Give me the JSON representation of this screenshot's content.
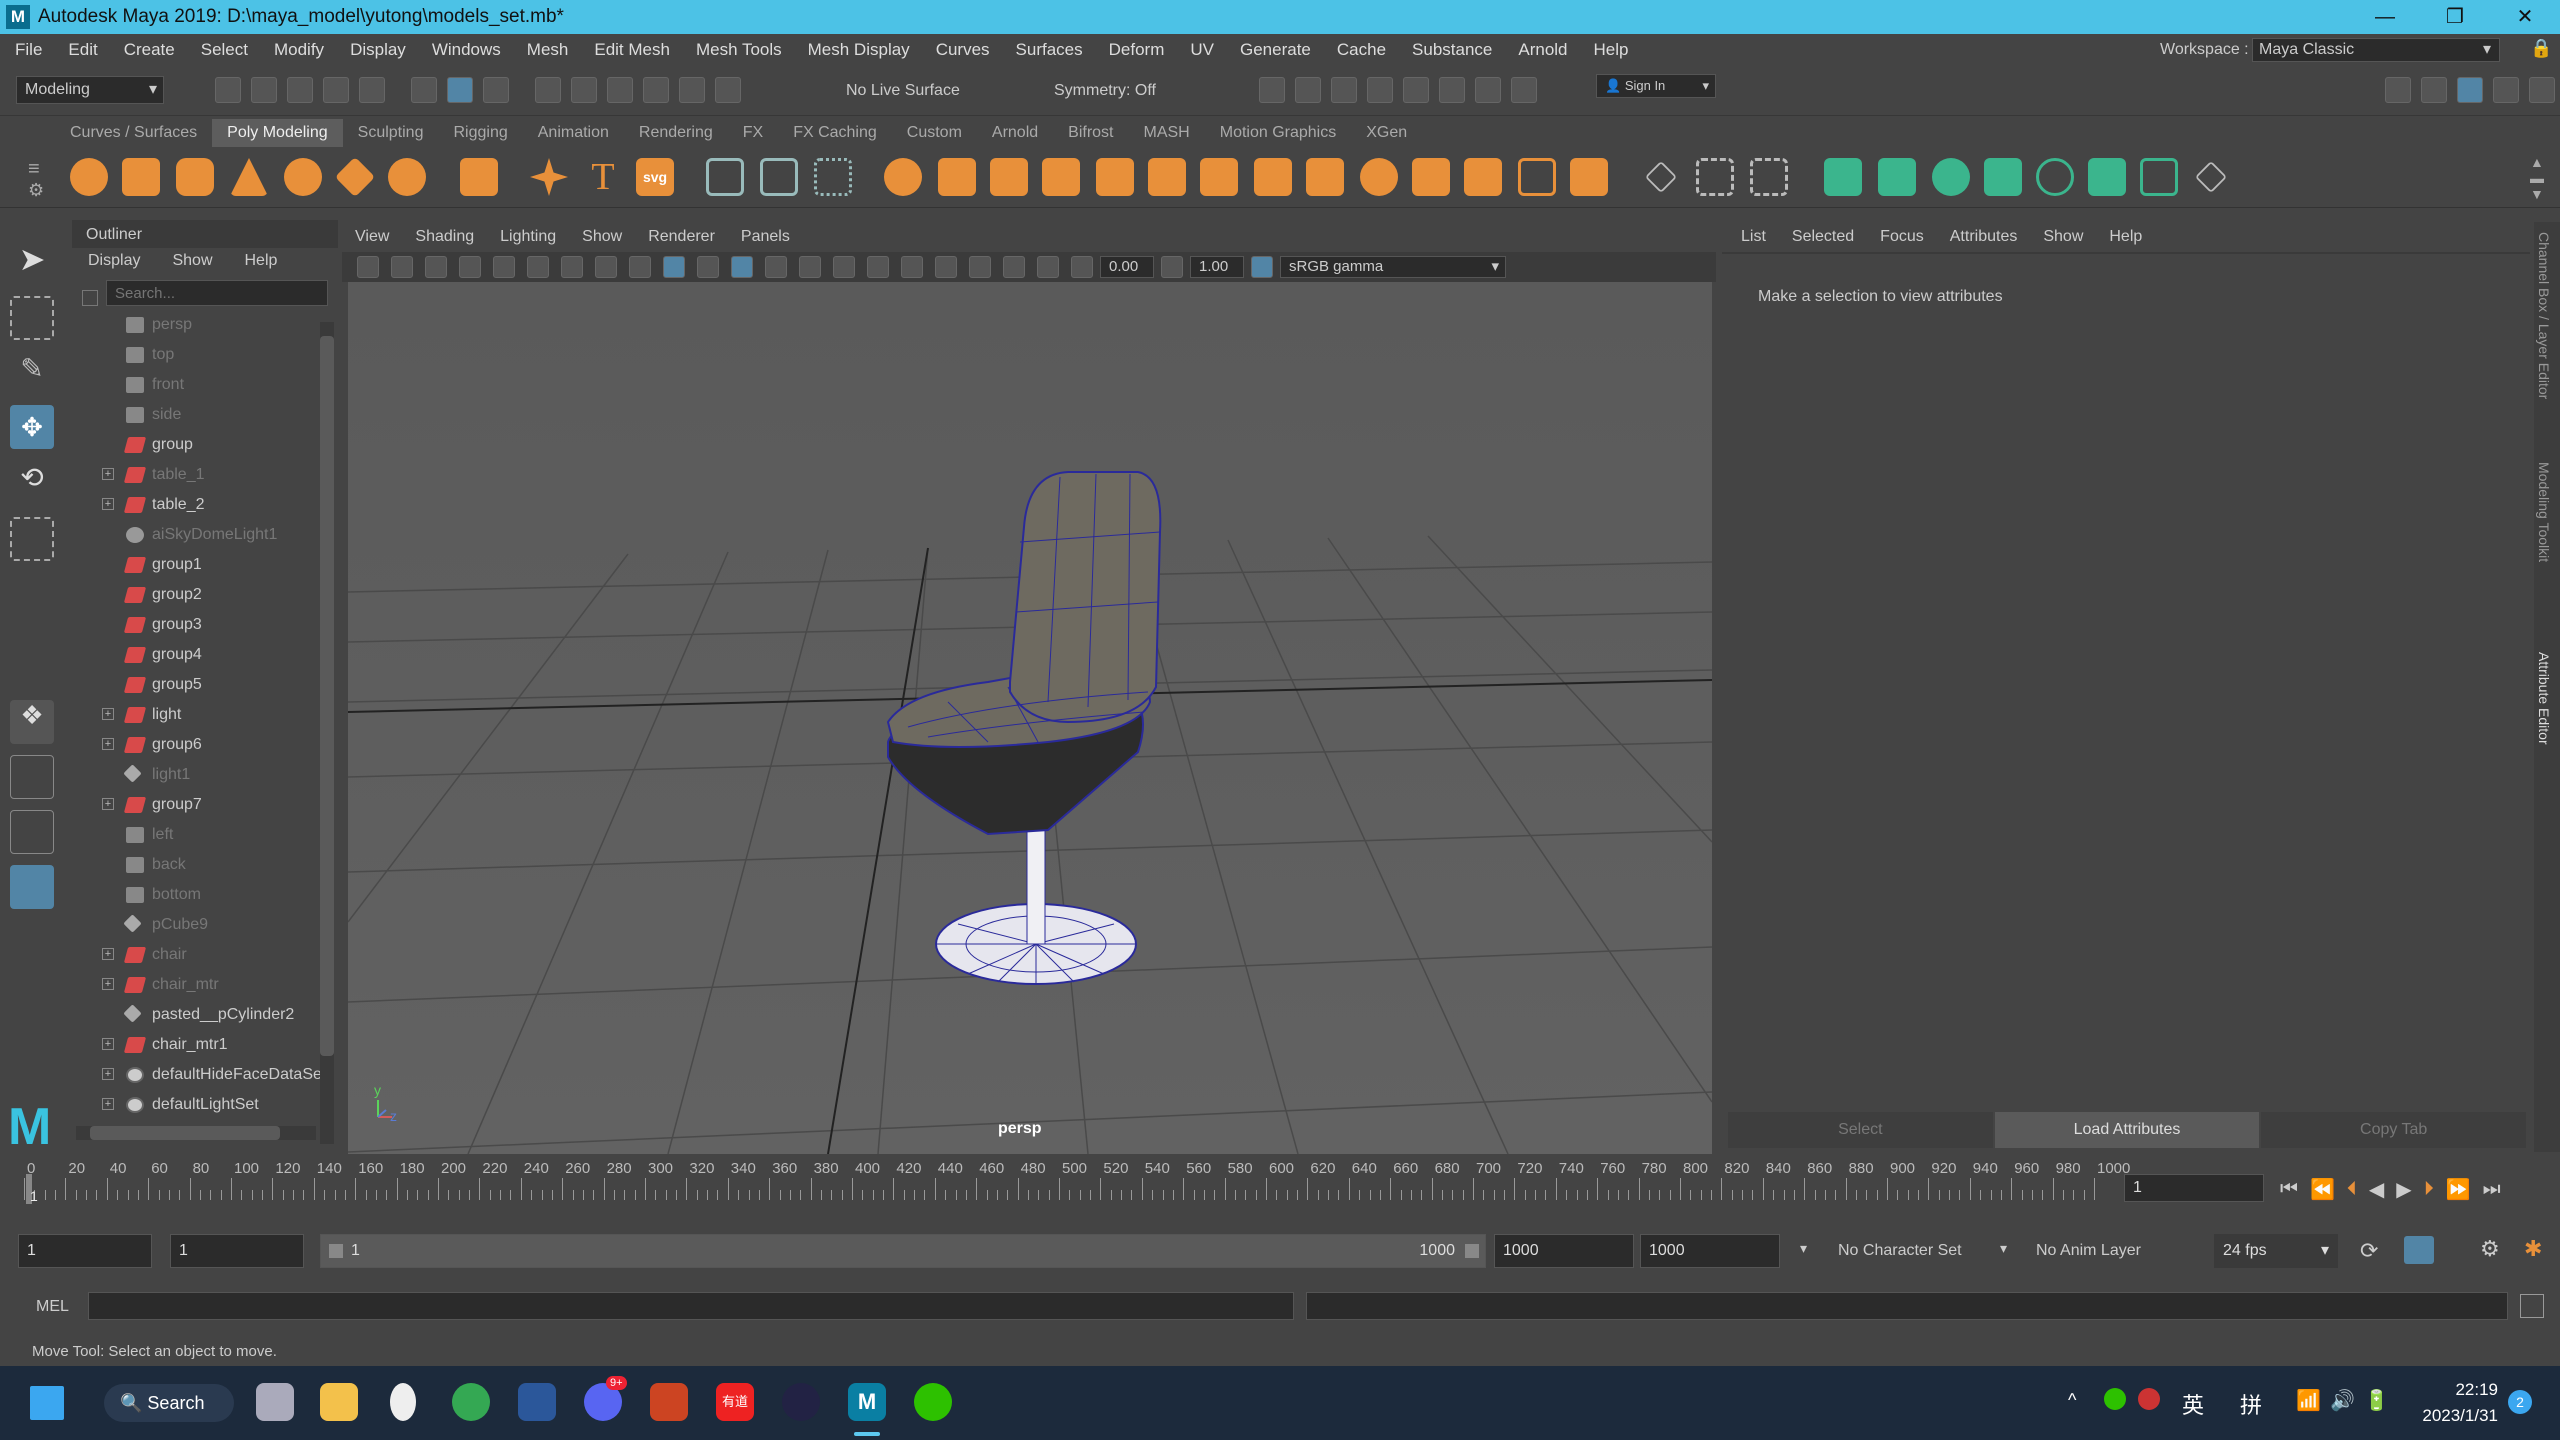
{
  "window": {
    "title": "Autodesk Maya 2019: D:\\maya_model\\yutong\\models_set.mb*",
    "logo": "M"
  },
  "menu": [
    "File",
    "Edit",
    "Create",
    "Select",
    "Modify",
    "Display",
    "Windows",
    "Mesh",
    "Edit Mesh",
    "Mesh Tools",
    "Mesh Display",
    "Curves",
    "Surfaces",
    "Deform",
    "UV",
    "Generate",
    "Cache",
    "Substance",
    "Arnold",
    "Help"
  ],
  "workspace": {
    "label": "Workspace :",
    "value": "Maya Classic"
  },
  "statusline": {
    "mode": "Modeling",
    "live_surface": "No Live Surface",
    "symmetry": "Symmetry: Off",
    "sign_in": "Sign In"
  },
  "shelf_tabs": [
    {
      "label": "Curves / Surfaces",
      "active": false
    },
    {
      "label": "Poly Modeling",
      "active": true
    },
    {
      "label": "Sculpting",
      "active": false
    },
    {
      "label": "Rigging",
      "active": false
    },
    {
      "label": "Animation",
      "active": false
    },
    {
      "label": "Rendering",
      "active": false
    },
    {
      "label": "FX",
      "active": false
    },
    {
      "label": "FX Caching",
      "active": false
    },
    {
      "label": "Custom",
      "active": false
    },
    {
      "label": "Arnold",
      "active": false
    },
    {
      "label": "Bifrost",
      "active": false
    },
    {
      "label": "MASH",
      "active": false
    },
    {
      "label": "Motion Graphics",
      "active": false
    },
    {
      "label": "XGen",
      "active": false
    }
  ],
  "shelf": {
    "text_tool": "T",
    "svg_tool": "svg",
    "accent": "#e8903a",
    "green_accent": "#3bb58d"
  },
  "outliner": {
    "title": "Outliner",
    "menu": [
      "Display",
      "Show",
      "Help"
    ],
    "search_placeholder": "Search...",
    "items": [
      {
        "label": "persp",
        "icon": "cam",
        "dim": true,
        "expand": false
      },
      {
        "label": "top",
        "icon": "cam",
        "dim": true,
        "expand": false
      },
      {
        "label": "front",
        "icon": "cam",
        "dim": true,
        "expand": false
      },
      {
        "label": "side",
        "icon": "cam",
        "dim": true,
        "expand": false
      },
      {
        "label": "group",
        "icon": "grp",
        "dim": false,
        "expand": false
      },
      {
        "label": "table_1",
        "icon": "grp",
        "dim": true,
        "expand": true
      },
      {
        "label": "table_2",
        "icon": "grp",
        "dim": false,
        "expand": true
      },
      {
        "label": "aiSkyDomeLight1",
        "icon": "light",
        "dim": true,
        "expand": false
      },
      {
        "label": "group1",
        "icon": "grp",
        "dim": false,
        "expand": false
      },
      {
        "label": "group2",
        "icon": "grp",
        "dim": false,
        "expand": false
      },
      {
        "label": "group3",
        "icon": "grp",
        "dim": false,
        "expand": false
      },
      {
        "label": "group4",
        "icon": "grp",
        "dim": false,
        "expand": false
      },
      {
        "label": "group5",
        "icon": "grp",
        "dim": false,
        "expand": false
      },
      {
        "label": "light",
        "icon": "grp",
        "dim": false,
        "expand": true
      },
      {
        "label": "group6",
        "icon": "grp",
        "dim": false,
        "expand": true
      },
      {
        "label": "light1",
        "icon": "mesh",
        "dim": true,
        "expand": false
      },
      {
        "label": "group7",
        "icon": "grp",
        "dim": false,
        "expand": true
      },
      {
        "label": "left",
        "icon": "cam",
        "dim": true,
        "expand": false
      },
      {
        "label": "back",
        "icon": "cam",
        "dim": true,
        "expand": false
      },
      {
        "label": "bottom",
        "icon": "cam",
        "dim": true,
        "expand": false
      },
      {
        "label": "pCube9",
        "icon": "mesh",
        "dim": true,
        "expand": false
      },
      {
        "label": "chair",
        "icon": "grp",
        "dim": true,
        "expand": true
      },
      {
        "label": "chair_mtr",
        "icon": "grp",
        "dim": true,
        "expand": true
      },
      {
        "label": "pasted__pCylinder2",
        "icon": "mesh",
        "dim": false,
        "expand": false
      },
      {
        "label": "chair_mtr1",
        "icon": "grp",
        "dim": false,
        "expand": true
      },
      {
        "label": "defaultHideFaceDataSet",
        "icon": "set",
        "dim": false,
        "expand": true
      },
      {
        "label": "defaultLightSet",
        "icon": "set",
        "dim": false,
        "expand": true
      }
    ]
  },
  "viewport": {
    "menu": [
      "View",
      "Shading",
      "Lighting",
      "Show",
      "Renderer",
      "Panels"
    ],
    "exposure": "0.00",
    "gamma": "1.00",
    "color_space": "sRGB gamma",
    "camera_label": "persp",
    "axis_y": "y",
    "axis_z": "z"
  },
  "attribute_editor": {
    "menu": [
      "List",
      "Selected",
      "Focus",
      "Attributes",
      "Show",
      "Help"
    ],
    "message": "Make a selection to view attributes",
    "buttons": [
      {
        "label": "Select",
        "on": false
      },
      {
        "label": "Load Attributes",
        "on": true
      },
      {
        "label": "Copy Tab",
        "on": false
      }
    ]
  },
  "side_tabs": [
    "Channel Box / Layer Editor",
    "Modeling Toolkit",
    "Attribute Editor"
  ],
  "timeline": {
    "ticks": [
      0,
      20,
      40,
      60,
      80,
      100,
      120,
      140,
      160,
      180,
      200,
      220,
      240,
      260,
      280,
      300,
      320,
      340,
      360,
      380,
      400,
      420,
      440,
      460,
      480,
      500,
      520,
      540,
      560,
      580,
      600,
      620,
      640,
      660,
      680,
      700,
      720,
      740,
      760,
      780,
      800,
      820,
      840,
      860,
      880,
      900,
      920,
      940,
      960,
      980,
      1000
    ],
    "current_frame": "1",
    "current_marker": "1"
  },
  "range": {
    "start": "1",
    "inner_start": "1",
    "slider_start": "1",
    "slider_end": "1000",
    "inner_end": "1000",
    "end": "1000",
    "character_set": "No Character Set",
    "anim_layer": "No Anim Layer",
    "fps": "24 fps"
  },
  "command": {
    "language": "MEL"
  },
  "help_line": "Move Tool: Select an object to move.",
  "taskbar": {
    "search": "Search",
    "tray": {
      "lang1": "英",
      "lang2": "拼",
      "time": "22:19",
      "date": "2023/1/31",
      "badge": "2",
      "discord_badge": "9+",
      "youdao": "有道"
    }
  }
}
